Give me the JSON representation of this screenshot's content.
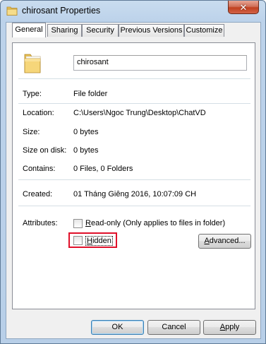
{
  "window": {
    "title": "chirosant Properties",
    "close_glyph": "✕",
    "title_icon": "folder-icon"
  },
  "tabs": [
    {
      "label": "General",
      "active": true
    },
    {
      "label": "Sharing",
      "active": false
    },
    {
      "label": "Security",
      "active": false
    },
    {
      "label": "Previous Versions",
      "active": false
    },
    {
      "label": "Customize",
      "active": false
    }
  ],
  "general": {
    "folder_icon": "folder-icon",
    "name_value": "chirosant",
    "type": {
      "label": "Type:",
      "value": "File folder"
    },
    "location": {
      "label": "Location:",
      "value": "C:\\Users\\Ngoc Trung\\Desktop\\ChatVD"
    },
    "size": {
      "label": "Size:",
      "value": "0 bytes"
    },
    "size_on_disk": {
      "label": "Size on disk:",
      "value": "0 bytes"
    },
    "contains": {
      "label": "Contains:",
      "value": "0 Files, 0 Folders"
    },
    "created": {
      "label": "Created:",
      "value": "01 Tháng Giêng 2016, 10:07:09 CH"
    },
    "attributes": {
      "label": "Attributes:",
      "read_only": {
        "label_prefix": "R",
        "label_rest": "ead-only (Only applies to files in folder)",
        "checked": false
      },
      "hidden": {
        "label_prefix": "H",
        "label_rest": "idden",
        "checked": false
      }
    },
    "advanced_button": {
      "prefix": "A",
      "label_rest": "dvanced..."
    }
  },
  "footer": {
    "ok_label": "OK",
    "cancel_label": "Cancel",
    "apply_prefix": "A",
    "apply_rest": "pply"
  },
  "colors": {
    "highlight_border": "#e0102a",
    "folder_yellow": "#f3d57a"
  }
}
